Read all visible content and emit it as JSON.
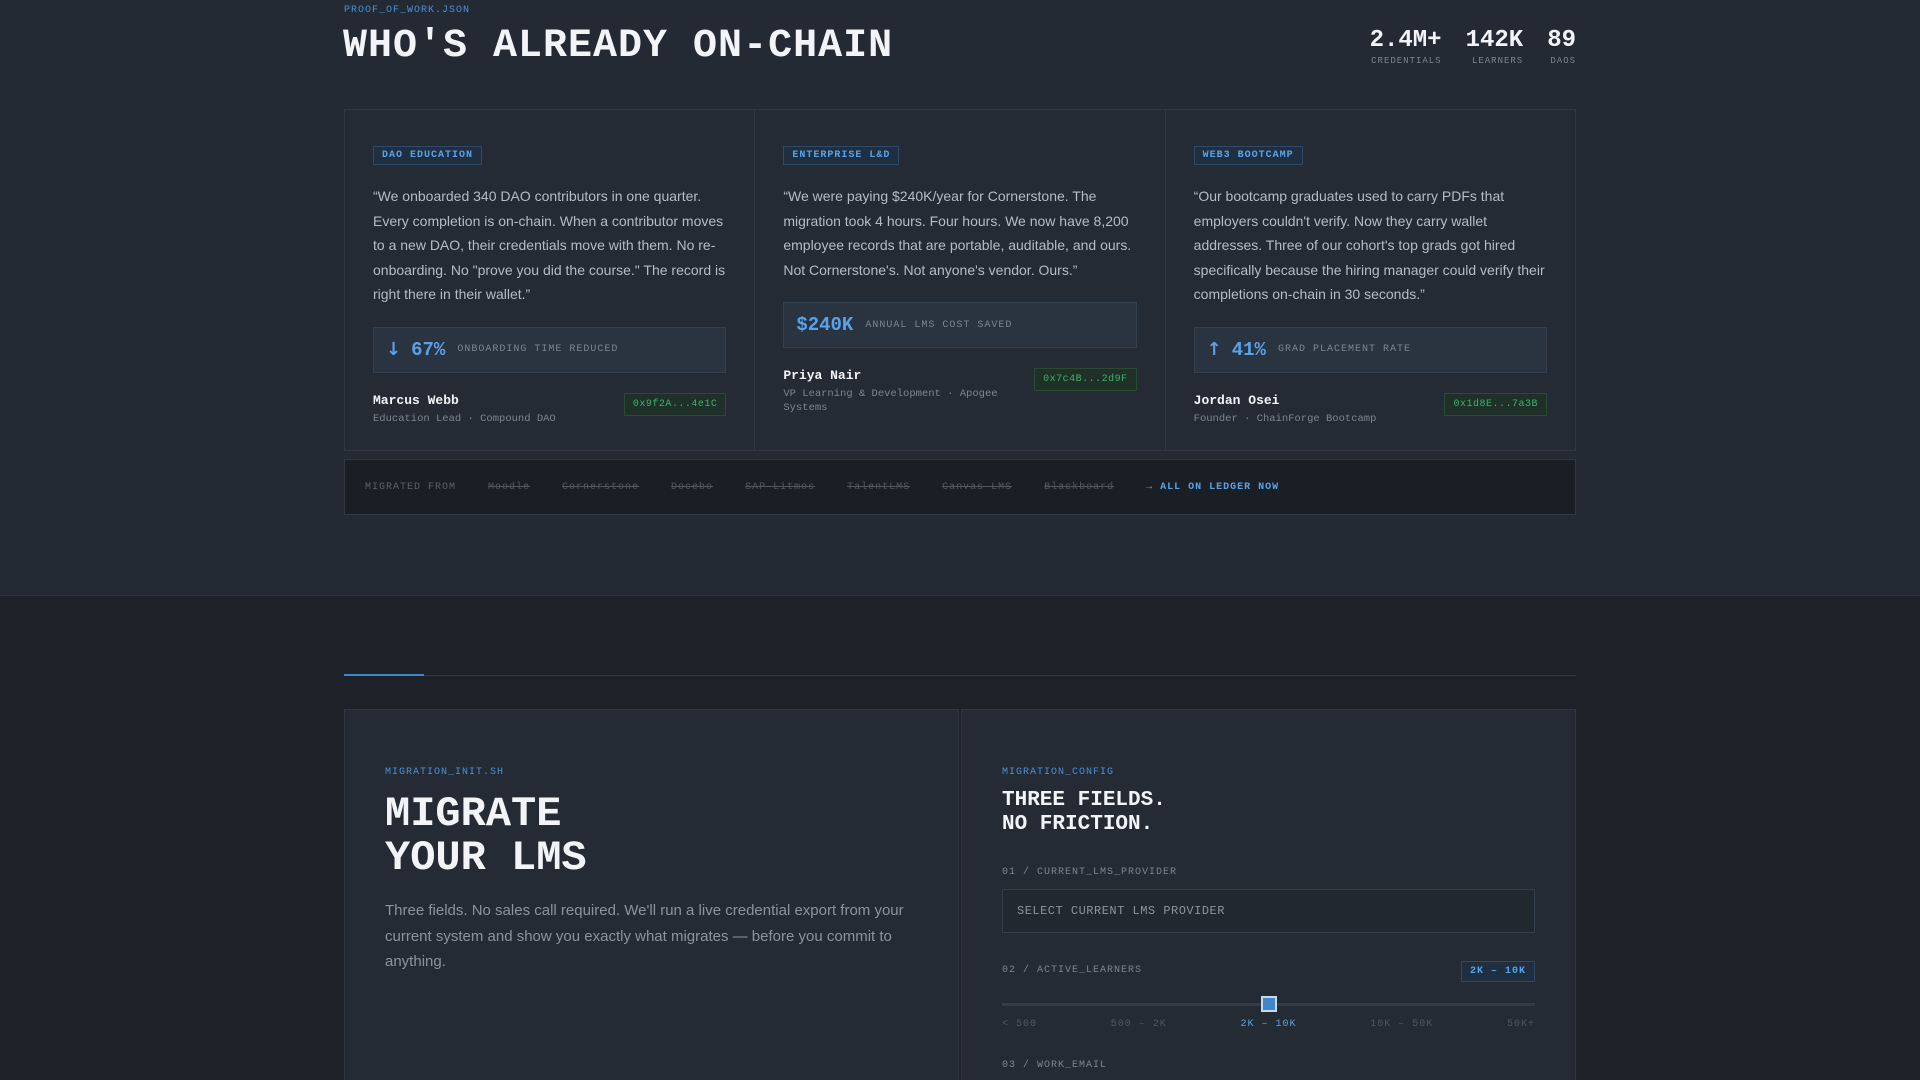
{
  "header": {
    "eyebrow": "PROOF_OF_WORK.JSON",
    "title": "WHO'S ALREADY ON-CHAIN",
    "stats": [
      {
        "value": "2.4M+",
        "label": "CREDENTIALS"
      },
      {
        "value": "142K",
        "label": "LEARNERS"
      },
      {
        "value": "89",
        "label": "DAOS"
      }
    ]
  },
  "testimonials": [
    {
      "tag": "DAO EDUCATION",
      "quote": "“We onboarded 340 DAO contributors in one quarter. Every completion is on-chain. When a contributor moves to a new DAO, their credentials move with them. No re-onboarding. No \"prove you did the course.\" The record is right there in their wallet.”",
      "metric_arrow": "↓",
      "metric_value": "67%",
      "metric_label": "ONBOARDING TIME REDUCED",
      "name": "Marcus Webb",
      "role": "Education Lead · Compound DAO",
      "wallet": "0x9f2A...4e1C"
    },
    {
      "tag": "ENTERPRISE L&D",
      "quote": "“We were paying $240K/year for Cornerstone. The migration took 4 hours. Four hours. We now have 8,200 employee records that are portable, auditable, and ours. Not Cornerstone's. Not anyone's vendor. Ours.”",
      "metric_arrow": "",
      "metric_value": "$240K",
      "metric_label": "ANNUAL LMS COST SAVED",
      "name": "Priya Nair",
      "role": "VP Learning & Development · Apogee Systems",
      "wallet": "0x7c4B...2d9F"
    },
    {
      "tag": "WEB3 BOOTCAMP",
      "quote": "“Our bootcamp graduates used to carry PDFs that employers couldn't verify. Now they carry wallet addresses. Three of our cohort's top grads got hired specifically because the hiring manager could verify their completions on-chain in 30 seconds.”",
      "metric_arrow": "↑",
      "metric_value": "41%",
      "metric_label": "GRAD PLACEMENT RATE",
      "name": "Jordan Osei",
      "role": "Founder · ChainForge Bootcamp",
      "wallet": "0x1d8E...7a3B"
    }
  ],
  "migrated": {
    "label": "MIGRATED FROM",
    "items": [
      "Moodle",
      "Cornerstone",
      "Docebo",
      "SAP Litmos",
      "TalentLMS",
      "Canvas LMS",
      "Blackboard"
    ],
    "now": "→ ALL ON LEDGER NOW"
  },
  "migrate": {
    "eyebrow": "MIGRATION_INIT.SH",
    "title_line1": "MIGRATE",
    "title_line2": "YOUR LMS",
    "description": "Three fields. No sales call required. We'll run a live credential export from your current system and show you exactly what migrates — before you commit to anything."
  },
  "config": {
    "eyebrow": "MIGRATION_CONFIG",
    "title_line1": "THREE FIELDS.",
    "title_line2": "NO FRICTION.",
    "field1_label": "01 / CURRENT_LMS_PROVIDER",
    "field1_placeholder": "SELECT CURRENT LMS PROVIDER",
    "field2_label": "02 / ACTIVE_LEARNERS",
    "field2_value": "2K – 10K",
    "slider_ticks": [
      "< 500",
      "500 – 2K",
      "2K – 10K",
      "10K – 50K",
      "50K+"
    ],
    "slider_selected_index": 2,
    "field3_label": "03 / WORK_EMAIL"
  },
  "colors": {
    "accent": "#3f86cf",
    "wallet_green": "#3fb26a",
    "background": "#1d2229"
  }
}
